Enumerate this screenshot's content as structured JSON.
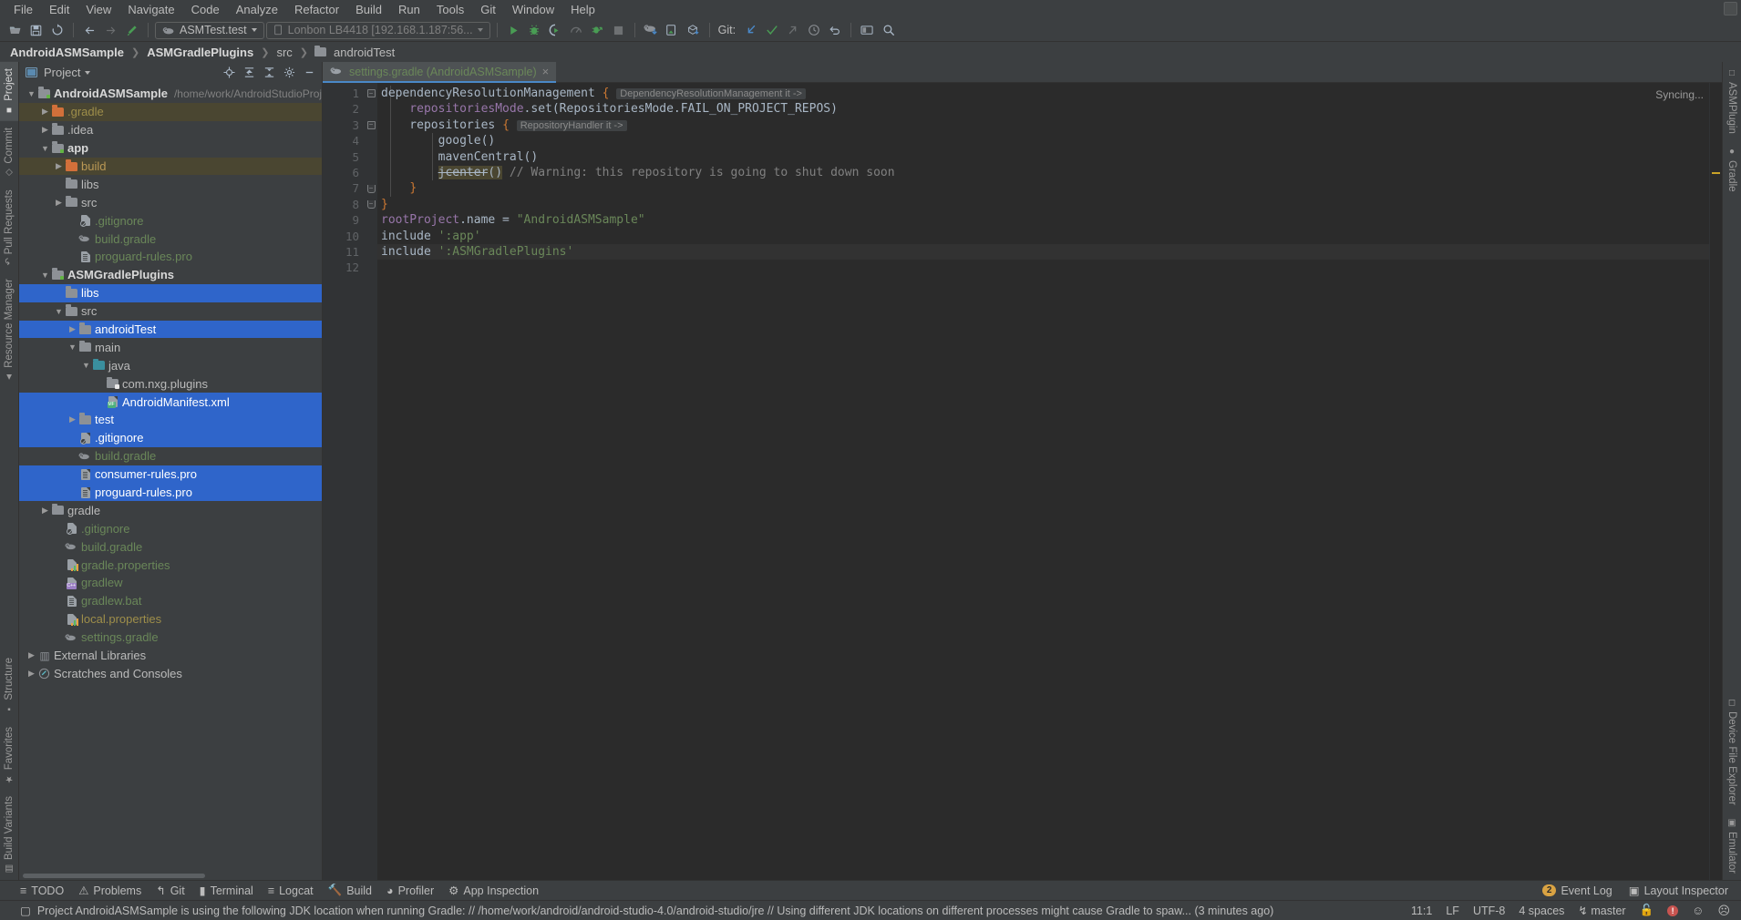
{
  "menu": {
    "items": [
      "File",
      "Edit",
      "View",
      "Navigate",
      "Code",
      "Analyze",
      "Refactor",
      "Build",
      "Run",
      "Tools",
      "Git",
      "Window",
      "Help"
    ]
  },
  "toolbar": {
    "run_config": "ASMTest.test",
    "device": "Lonbon LB4418 [192.168.1.187:56...",
    "git_label": "Git:",
    "icons": [
      "open-folder-icon",
      "save-icon",
      "sync-icon",
      "back-icon",
      "forward-icon",
      "build-hammer-icon",
      "run-icon",
      "debug-icon",
      "run-coverage-icon",
      "profiler-icon",
      "apply-changes-icon",
      "stop-icon",
      "sync-gradle-icon",
      "avd-manager-icon",
      "sdk-manager-icon",
      "update-project-icon",
      "commit-icon",
      "search-icon"
    ]
  },
  "breadcrumb": {
    "items": [
      "AndroidASMSample",
      "ASMGradlePlugins",
      "src",
      "androidTest"
    ]
  },
  "left_rail": {
    "top": [
      "Project",
      "Commit",
      "Pull Requests",
      "Resource Manager"
    ],
    "bottom": [
      "Structure",
      "Favorites",
      "Build Variants"
    ]
  },
  "right_rail": {
    "top": [
      "ASMPlugin",
      "Gradle"
    ],
    "bottom": [
      "Device File Explorer",
      "Emulator"
    ]
  },
  "project_panel": {
    "title": "Project",
    "actions": [
      "locate-icon",
      "collapse-all-icon",
      "expand-icon",
      "settings-gear-icon",
      "minimize-icon"
    ]
  },
  "tree": [
    {
      "label": "AndroidASMSample",
      "path": "/home/work/AndroidStudioProjects/A",
      "indent": 0,
      "arrow": "down",
      "icon": "module-folder",
      "color": "bold",
      "state": "normal"
    },
    {
      "label": ".gradle",
      "path": "",
      "indent": 1,
      "arrow": "right",
      "icon": "folder-orange",
      "color": "yellow",
      "state": "highlight"
    },
    {
      "label": ".idea",
      "path": "",
      "indent": 1,
      "arrow": "right",
      "icon": "folder-gray",
      "color": "default",
      "state": "normal"
    },
    {
      "label": "app",
      "path": "",
      "indent": 1,
      "arrow": "down",
      "icon": "module-folder",
      "color": "bold",
      "state": "normal"
    },
    {
      "label": "build",
      "path": "",
      "indent": 2,
      "arrow": "right",
      "icon": "folder-orange",
      "color": "orange",
      "state": "highlight"
    },
    {
      "label": "libs",
      "path": "",
      "indent": 2,
      "arrow": "none",
      "icon": "folder-gray",
      "color": "default",
      "state": "normal"
    },
    {
      "label": "src",
      "path": "",
      "indent": 2,
      "arrow": "right",
      "icon": "folder-gray",
      "color": "default",
      "state": "normal"
    },
    {
      "label": ".gitignore",
      "path": "",
      "indent": 3,
      "arrow": "none",
      "icon": "doc-git",
      "color": "green",
      "state": "normal"
    },
    {
      "label": "build.gradle",
      "path": "",
      "indent": 3,
      "arrow": "none",
      "icon": "gradle-file",
      "color": "green",
      "state": "normal"
    },
    {
      "label": "proguard-rules.pro",
      "path": "",
      "indent": 3,
      "arrow": "none",
      "icon": "doc-text",
      "color": "green",
      "state": "normal"
    },
    {
      "label": "ASMGradlePlugins",
      "path": "",
      "indent": 1,
      "arrow": "down",
      "icon": "module-lib",
      "color": "bold",
      "state": "normal"
    },
    {
      "label": "libs",
      "path": "",
      "indent": 2,
      "arrow": "none",
      "icon": "folder-gray",
      "color": "default",
      "state": "selected"
    },
    {
      "label": "src",
      "path": "",
      "indent": 2,
      "arrow": "down",
      "icon": "folder-gray",
      "color": "default",
      "state": "normal"
    },
    {
      "label": "androidTest",
      "path": "",
      "indent": 3,
      "arrow": "right",
      "icon": "folder-gray",
      "color": "default",
      "state": "selected"
    },
    {
      "label": "main",
      "path": "",
      "indent": 3,
      "arrow": "down",
      "icon": "folder-gray",
      "color": "default",
      "state": "normal"
    },
    {
      "label": "java",
      "path": "",
      "indent": 4,
      "arrow": "down",
      "icon": "folder-teal",
      "color": "default",
      "state": "normal"
    },
    {
      "label": "com.nxg.plugins",
      "path": "",
      "indent": 5,
      "arrow": "none",
      "icon": "folder-pkg",
      "color": "default",
      "state": "normal"
    },
    {
      "label": "AndroidManifest.xml",
      "path": "",
      "indent": 5,
      "arrow": "none",
      "icon": "doc-manifest",
      "color": "default",
      "state": "selected"
    },
    {
      "label": "test",
      "path": "",
      "indent": 3,
      "arrow": "right",
      "icon": "folder-gray",
      "color": "default",
      "state": "selected"
    },
    {
      "label": ".gitignore",
      "path": "",
      "indent": 3,
      "arrow": "none",
      "icon": "doc-git",
      "color": "green",
      "state": "selected"
    },
    {
      "label": "build.gradle",
      "path": "",
      "indent": 3,
      "arrow": "none",
      "icon": "gradle-file",
      "color": "green",
      "state": "normal"
    },
    {
      "label": "consumer-rules.pro",
      "path": "",
      "indent": 3,
      "arrow": "none",
      "icon": "doc-text",
      "color": "default",
      "state": "selected"
    },
    {
      "label": "proguard-rules.pro",
      "path": "",
      "indent": 3,
      "arrow": "none",
      "icon": "doc-text",
      "color": "default",
      "state": "selected"
    },
    {
      "label": "gradle",
      "path": "",
      "indent": 1,
      "arrow": "right",
      "icon": "folder-gray",
      "color": "default",
      "state": "normal"
    },
    {
      "label": ".gitignore",
      "path": "",
      "indent": 2,
      "arrow": "none",
      "icon": "doc-git",
      "color": "green",
      "state": "normal"
    },
    {
      "label": "build.gradle",
      "path": "",
      "indent": 2,
      "arrow": "none",
      "icon": "gradle-file",
      "color": "green",
      "state": "normal"
    },
    {
      "label": "gradle.properties",
      "path": "",
      "indent": 2,
      "arrow": "none",
      "icon": "doc-props",
      "color": "green",
      "state": "normal"
    },
    {
      "label": "gradlew",
      "path": "",
      "indent": 2,
      "arrow": "none",
      "icon": "doc-cpp",
      "color": "green",
      "state": "normal"
    },
    {
      "label": "gradlew.bat",
      "path": "",
      "indent": 2,
      "arrow": "none",
      "icon": "doc-text",
      "color": "green",
      "state": "normal"
    },
    {
      "label": "local.properties",
      "path": "",
      "indent": 2,
      "arrow": "none",
      "icon": "doc-props",
      "color": "yellow",
      "state": "normal"
    },
    {
      "label": "settings.gradle",
      "path": "",
      "indent": 2,
      "arrow": "none",
      "icon": "gradle-file",
      "color": "green",
      "state": "normal"
    },
    {
      "label": "External Libraries",
      "path": "",
      "indent": 0,
      "arrow": "right",
      "icon": "libraries",
      "color": "default",
      "state": "normal"
    },
    {
      "label": "Scratches and Consoles",
      "path": "",
      "indent": 0,
      "arrow": "right",
      "icon": "scratches",
      "color": "default",
      "state": "normal"
    }
  ],
  "editor": {
    "tab_label": "settings.gradle (AndroidASMSample)",
    "tab_close": "×",
    "syncing_label": "Syncing...",
    "current_line": 11,
    "lines": [
      {
        "n": 1,
        "fold": "minus",
        "segments": [
          {
            "t": "dependencyResolutionManagement ",
            "c": "fn"
          },
          {
            "t": "{",
            "c": "k"
          },
          {
            "t": " ",
            "c": "fn"
          },
          {
            "t": "DependencyResolutionManagement it ->",
            "c": "hint"
          }
        ]
      },
      {
        "n": 2,
        "fold": "",
        "segments": [
          {
            "t": "    repositoriesMode",
            "c": "pv"
          },
          {
            "t": ".set(RepositoriesMode.FAIL_ON_PROJECT_REPOS)",
            "c": "fn"
          }
        ]
      },
      {
        "n": 3,
        "fold": "minus",
        "segments": [
          {
            "t": "    repositories ",
            "c": "fn"
          },
          {
            "t": "{",
            "c": "k"
          },
          {
            "t": " ",
            "c": "fn"
          },
          {
            "t": "RepositoryHandler it ->",
            "c": "hint"
          }
        ]
      },
      {
        "n": 4,
        "fold": "",
        "segments": [
          {
            "t": "        google()",
            "c": "fn"
          }
        ]
      },
      {
        "n": 5,
        "fold": "",
        "segments": [
          {
            "t": "        mavenCentral()",
            "c": "fn"
          }
        ]
      },
      {
        "n": 6,
        "fold": "",
        "segments": [
          {
            "t": "        ",
            "c": "fn"
          },
          {
            "t": "jcenter",
            "c": "dep"
          },
          {
            "t": "()",
            "c": "dep-tail"
          },
          {
            "t": " // Warning: this repository is going to shut down soon",
            "c": "cm"
          }
        ]
      },
      {
        "n": 7,
        "fold": "minus-end",
        "segments": [
          {
            "t": "    ",
            "c": "fn"
          },
          {
            "t": "}",
            "c": "k"
          }
        ]
      },
      {
        "n": 8,
        "fold": "minus-end",
        "segments": [
          {
            "t": "",
            "c": "fn"
          },
          {
            "t": "}",
            "c": "k"
          }
        ]
      },
      {
        "n": 9,
        "fold": "",
        "segments": [
          {
            "t": "rootProject",
            "c": "pv"
          },
          {
            "t": ".name = ",
            "c": "fn"
          },
          {
            "t": "\"AndroidASMSample\"",
            "c": "st"
          }
        ]
      },
      {
        "n": 10,
        "fold": "",
        "segments": [
          {
            "t": "include ",
            "c": "fn"
          },
          {
            "t": "':app'",
            "c": "st"
          }
        ]
      },
      {
        "n": 11,
        "fold": "",
        "segments": [
          {
            "t": "include ",
            "c": "fn"
          },
          {
            "t": "':ASMGradlePlugins'",
            "c": "st"
          }
        ]
      },
      {
        "n": 12,
        "fold": "",
        "segments": []
      }
    ]
  },
  "bottom_tools": {
    "left": [
      {
        "label": "TODO",
        "icon": "todo-icon"
      },
      {
        "label": "Problems",
        "icon": "problems-icon"
      },
      {
        "label": "Git",
        "icon": "git-branch-icon"
      },
      {
        "label": "Terminal",
        "icon": "terminal-icon"
      },
      {
        "label": "Logcat",
        "icon": "logcat-icon"
      },
      {
        "label": "Build",
        "icon": "build-hammer-icon"
      },
      {
        "label": "Profiler",
        "icon": "profiler-icon"
      },
      {
        "label": "App Inspection",
        "icon": "app-inspection-icon"
      }
    ],
    "right": [
      {
        "label": "Event Log",
        "icon": "event-log-icon",
        "count": "2"
      },
      {
        "label": "Layout Inspector",
        "icon": "layout-inspector-icon",
        "count": ""
      }
    ]
  },
  "status_bar": {
    "message": "Project AndroidASMSample is using the following JDK location when running Gradle: // /home/work/android/android-studio-4.0/android-studio/jre // Using different JDK locations on different processes might cause Gradle to spaw... (3 minutes ago)",
    "caret": "11:1",
    "line_sep": "LF",
    "encoding": "UTF-8",
    "indent": "4 spaces",
    "branch": "master",
    "lock_icon": "unlocked-icon",
    "error_count": "!",
    "faces": [
      "☺",
      "☹"
    ]
  },
  "colors": {
    "accent_blue": "#2f65ca",
    "highlight_olive": "#4a4631",
    "green_text": "#6a8759",
    "panel_bg": "#3c3f41",
    "editor_bg": "#2b2b2b"
  }
}
